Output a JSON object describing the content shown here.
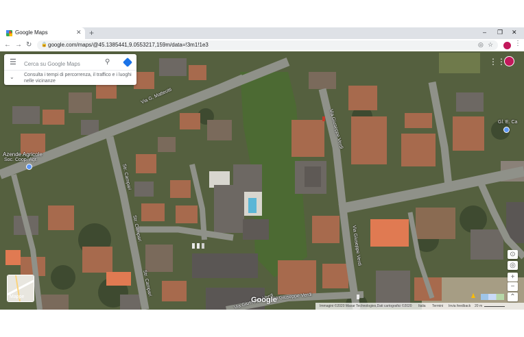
{
  "browser": {
    "tab": {
      "title": "Google Maps",
      "close_glyph": "✕"
    },
    "new_tab_glyph": "+",
    "window_controls": {
      "minimize": "–",
      "maximize": "❐",
      "close": "✕"
    },
    "nav": {
      "back": "←",
      "forward": "→",
      "reload": "↻"
    },
    "url": "google.com/maps/@45.1385441,9.0553217,159m/data=!3m1!1e3",
    "icons": {
      "lock": "lock-icon",
      "location": "location-target-icon",
      "bookmark": "star-icon",
      "profile": "profile-avatar",
      "menu": "more-vert-icon"
    },
    "glyphs": {
      "lock": "🔒",
      "location": "◎",
      "star": "☆",
      "menu": "⋮"
    }
  },
  "search_panel": {
    "placeholder": "Cerca su Google Maps",
    "hint": "Consulta i tempi di percorrenza, il traffico e i luoghi nelle vicinanze",
    "menu_glyph": "☰",
    "search_glyph": "⚲",
    "chevron_glyph": "⌄"
  },
  "map": {
    "type": "satellite",
    "streets": {
      "matteotti": "Via G. Matteotti",
      "campari_1": "Str. Campari",
      "campari_2": "Str. Campari",
      "campari_3": "Str. Campari",
      "verdi_1": "Via Giuseppe Verdi",
      "verdi_2": "Via Giuseppe Verdi",
      "verdi_3": "Via Giuseppe Verdi",
      "verdi_4": "Via Giuseppe Verdi"
    },
    "poi_labels": {
      "azienda_line1": "Azende Agricole",
      "azienda_line2": "Soc. Coop. Agr.",
      "top_right": "Gl. E. Ca"
    },
    "apps_glyph": "⋮⋮⋮",
    "layers_label": "Mappe",
    "logo": "Google",
    "controls": {
      "compass": "⊙",
      "target": "◎",
      "zoom_in": "+",
      "zoom_out": "−",
      "collapse": "⌃"
    },
    "pegman_glyph": "♟",
    "footer": {
      "copyright": "Immagini ©2020 Maxar Technologies,Dati cartografici ©2020",
      "country": "Italia",
      "terms": "Termini",
      "feedback": "Invia feedback",
      "scale": "20 m"
    }
  },
  "colors": {
    "tabbar": "#dee1e6",
    "omnibox": "#f1f3f4",
    "directions": "#1a73e8",
    "avatar": "#c2185b",
    "road": "#8f9189",
    "roof_red": "#a76a4d",
    "roof_gray": "#6d6863",
    "vegetation_dark": "#3e4a30"
  }
}
